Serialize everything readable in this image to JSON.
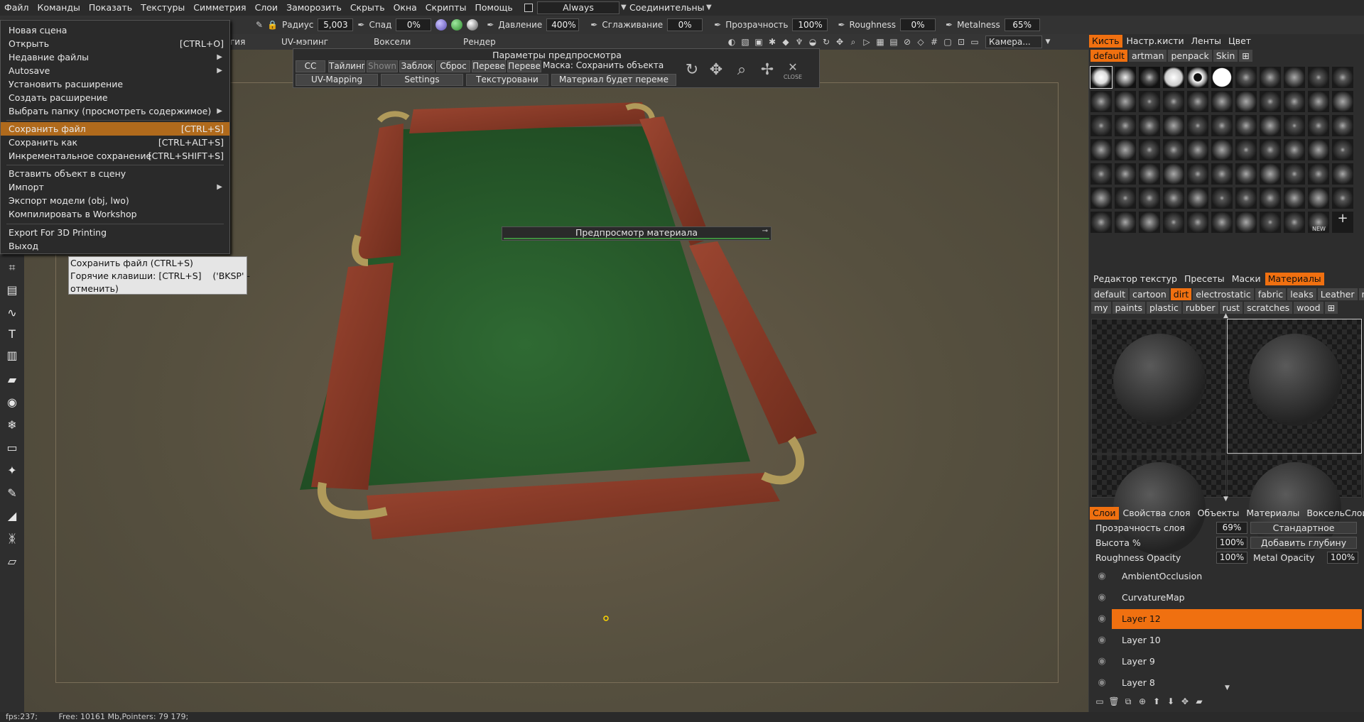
{
  "menubar": {
    "items": [
      "Файл",
      "Команды",
      "Показать",
      "Текстуры",
      "Симметрия",
      "Слои",
      "Заморозить",
      "Скрыть",
      "Окна",
      "Скрипты",
      "Помощь"
    ],
    "always_label": "Always",
    "connective_label": "Соединительны"
  },
  "toolbar": {
    "radius_label": "Радиус",
    "radius_value": "5,003",
    "falloff_label": "Спад",
    "falloff_value": "0%",
    "pressure_label": "Давление",
    "pressure_value": "400%",
    "smoothing_label": "Сглаживание",
    "smoothing_value": "0%",
    "transparency_label": "Прозрачность",
    "transparency_value": "100%",
    "roughness_label": "Roughness",
    "roughness_value": "0%",
    "metalness_label": "Metalness",
    "metalness_value": "65%",
    "ball_colors": [
      "#7a6cc9",
      "#3fa83f",
      "#aaaaaa"
    ]
  },
  "row2": {
    "rooms": [
      "гия",
      "UV-мэпинг",
      "Воксели",
      "Рендер"
    ],
    "camera_label": "Камера...",
    "icons": [
      "sphere-icon",
      "image-icon",
      "box-icon",
      "light-icon",
      "drop-icon",
      "fork-icon",
      "sphere-half-icon",
      "rotate-icon",
      "move-icon",
      "zoom-icon",
      "play-icon",
      "grid-all-icon",
      "grid-icon",
      "forbid-icon",
      "cube-icon",
      "hash-icon",
      "frame-icon",
      "fit-icon",
      "render-icon"
    ]
  },
  "file_menu": {
    "items": [
      {
        "label": "Новая сцена",
        "shortcut": "",
        "arrow": false,
        "highlight": false
      },
      {
        "label": "Открыть",
        "shortcut": "[CTRL+O]",
        "arrow": false,
        "highlight": false
      },
      {
        "label": "Недавние файлы",
        "shortcut": "",
        "arrow": true,
        "highlight": false
      },
      {
        "label": "Autosave",
        "shortcut": "",
        "arrow": true,
        "highlight": false
      },
      {
        "label": "Установить расширение",
        "shortcut": "",
        "arrow": false,
        "highlight": false
      },
      {
        "label": "Создать расширение",
        "shortcut": "",
        "arrow": false,
        "highlight": false
      },
      {
        "label": "Выбрать папку (просмотреть содержимое)",
        "shortcut": "",
        "arrow": true,
        "highlight": false
      },
      {
        "label": "Сохранить файл",
        "shortcut": "[CTRL+S]",
        "arrow": false,
        "highlight": true
      },
      {
        "label": "Сохранить как",
        "shortcut": "[CTRL+ALT+S]",
        "arrow": false,
        "highlight": false
      },
      {
        "label": "Инкрементальное сохранение",
        "shortcut": "[CTRL+SHIFT+S]",
        "arrow": false,
        "highlight": false
      },
      {
        "label": "Вставить объект в сцену",
        "shortcut": "",
        "arrow": false,
        "highlight": false
      },
      {
        "label": "Импорт",
        "shortcut": "",
        "arrow": true,
        "highlight": false
      },
      {
        "label": "Экспорт модели (obj, lwo)",
        "shortcut": "",
        "arrow": false,
        "highlight": false
      },
      {
        "label": "Компилировать в Workshop",
        "shortcut": "",
        "arrow": false,
        "highlight": false
      },
      {
        "label": "Export For 3D Printing",
        "shortcut": "",
        "arrow": false,
        "highlight": false
      },
      {
        "label": "Выход",
        "shortcut": "",
        "arrow": false,
        "highlight": false
      }
    ],
    "arrow_glyph": "▶"
  },
  "tooltip": {
    "line1": "Сохранить файл (CTRL+S)",
    "line2": "Горячие клавиши: [CTRL+S]    ('BKSP' -",
    "line3": "отменить)"
  },
  "preview_panel": {
    "title": "Параметры предпросмотра",
    "row1": [
      "CC",
      "Тайлинг",
      "Shown",
      "Заблок",
      "Сброс",
      "Переве",
      "Переве",
      "Маска: Сохранить объекта"
    ],
    "row2": [
      "UV-Mapping",
      "Settings",
      "Текстуровани",
      "Материал будет переме"
    ],
    "close_label": "CLOSE"
  },
  "material_preview": {
    "title": "Предпросмотр материала"
  },
  "brush_panel": {
    "tabs": [
      "Кисть",
      "Настр.кисти",
      "Ленты",
      "Цвет"
    ],
    "chips": [
      "default",
      "artman",
      "penpack",
      "Skin"
    ],
    "new_label": "NEW"
  },
  "materials_panel": {
    "tabs": [
      "Редактор текстур",
      "Пресеты",
      "Маски",
      "Материалы"
    ],
    "chips_row1": [
      "default",
      "cartoon",
      "dirt",
      "electrostatic",
      "fabric",
      "leaks",
      "Leather",
      "metals"
    ],
    "chips_row2": [
      "my",
      "paints",
      "plastic",
      "rubber",
      "rust",
      "scratches",
      "wood"
    ],
    "active_chip": "dirt"
  },
  "layers_panel": {
    "tabs": [
      "Слои",
      "Свойства слоя",
      "Объекты",
      "Материалы",
      "ВоксельСлои"
    ],
    "opacity_label": "Прозрачность слоя",
    "opacity_value": "69%",
    "blend_mode": "Стандартное",
    "height_label": "Высота %",
    "height_value": "100%",
    "depth_label": "Добавить глубину",
    "roughness_opacity_label": "Roughness Opacity",
    "roughness_opacity_value": "100%",
    "metal_opacity_label": "Metal Opacity",
    "metal_opacity_value": "100%",
    "layers": [
      {
        "name": "AmbientOcclusion",
        "selected": false
      },
      {
        "name": "CurvatureMap",
        "selected": false
      },
      {
        "name": "Layer 12",
        "selected": true
      },
      {
        "name": "Layer 10",
        "selected": false
      },
      {
        "name": "Layer 9",
        "selected": false
      },
      {
        "name": "Layer 8",
        "selected": false
      }
    ]
  },
  "status": {
    "fps": "fps:237;",
    "free": "Free: 10161 Mb,Pointers: 79 179;"
  },
  "colors": {
    "accent": "#f07010",
    "menu_highlight": "#b06a1c",
    "felt": "#2c5a2c",
    "wood": "#8c3a26",
    "brass": "#b09a5a"
  }
}
